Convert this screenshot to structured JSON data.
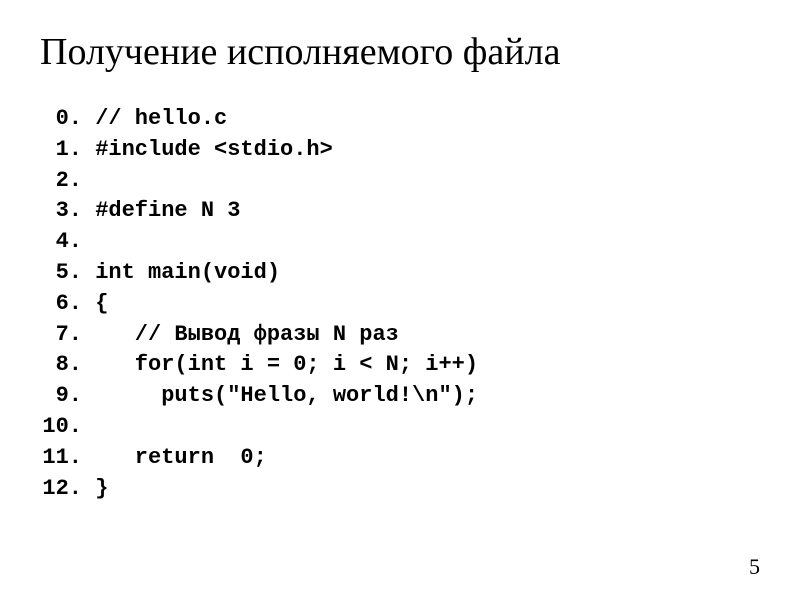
{
  "title": "Получение исполняемого файла",
  "code": {
    "lines": [
      {
        "num": " 0.",
        "text": " // hello.c"
      },
      {
        "num": " 1.",
        "text": " #include <stdio.h>"
      },
      {
        "num": " 2.",
        "text": ""
      },
      {
        "num": " 3.",
        "text": " #define N 3"
      },
      {
        "num": " 4.",
        "text": ""
      },
      {
        "num": " 5.",
        "text": " int main(void)"
      },
      {
        "num": " 6.",
        "text": " {"
      },
      {
        "num": " 7.",
        "text": "    // Вывод фразы N раз"
      },
      {
        "num": " 8.",
        "text": "    for(int i = 0; i < N; i++)"
      },
      {
        "num": " 9.",
        "text": "      puts(\"Hello, world!\\n\");"
      },
      {
        "num": "10.",
        "text": ""
      },
      {
        "num": "11.",
        "text": "    return  0;"
      },
      {
        "num": "12.",
        "text": " }"
      }
    ]
  },
  "page_number": "5"
}
